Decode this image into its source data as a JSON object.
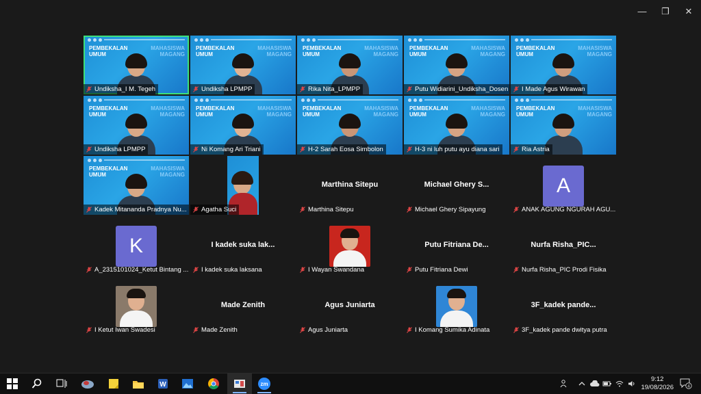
{
  "window": {
    "minimize": "—",
    "restore": "❐",
    "close": "✕"
  },
  "slide": {
    "title_line1": "PEMBEKALAN",
    "title_line2": "UMUM",
    "right_line1": "MAHASISWA",
    "right_line2": "MAGANG"
  },
  "tiles": [
    {
      "kind": "video",
      "name": "Undiksha_I M. Tegeh",
      "active": true
    },
    {
      "kind": "video",
      "name": "Undiksha LPMPP"
    },
    {
      "kind": "video",
      "name": "Rika Nita_LPMPP"
    },
    {
      "kind": "video",
      "name": "Putu Widiarini_Undiksha_Dosen"
    },
    {
      "kind": "video",
      "name": "I Made Agus Wirawan"
    },
    {
      "kind": "video",
      "name": "Undiksha LPMPP"
    },
    {
      "kind": "video",
      "name": "Ni Komang Ari Triani"
    },
    {
      "kind": "video",
      "name": "H-2 Sarah Eosa Simbolon"
    },
    {
      "kind": "video",
      "name": "H-3 ni luh putu ayu diana sari"
    },
    {
      "kind": "video",
      "name": "Ria Astria"
    },
    {
      "kind": "video",
      "name": "Kadek Mitananda Pradnya Nu..."
    },
    {
      "kind": "photo-video",
      "name": "Agatha Suci"
    },
    {
      "kind": "text",
      "big": "Marthina Sitepu",
      "name": "Marthina Sitepu"
    },
    {
      "kind": "text",
      "big": "Michael Ghery S...",
      "name": "Michael Ghery Sipayung"
    },
    {
      "kind": "avatar",
      "letter": "A",
      "name": "ANAK AGUNG NGURAH AGU..."
    },
    {
      "kind": "avatar",
      "letter": "K",
      "name": "A_2315101024_Ketut Bintang ..."
    },
    {
      "kind": "text",
      "big": "I kadek suka lak...",
      "name": "I kadek suka laksana"
    },
    {
      "kind": "photo",
      "bg": "#c8261e",
      "name": "I Wayan Swandana"
    },
    {
      "kind": "text",
      "big": "Putu Fitriana De...",
      "name": "Putu Fitriana Dewi"
    },
    {
      "kind": "text",
      "big": "Nurfa Risha_PIC...",
      "name": "Nurfa Risha_PIC Prodi Fisika"
    },
    {
      "kind": "photo",
      "bg": "#8a7a6a",
      "name": "I Ketut Iwan Swadesi"
    },
    {
      "kind": "text",
      "big": "Made Zenith",
      "name": "Made Zenith"
    },
    {
      "kind": "text",
      "big": "Agus Juniarta",
      "name": "Agus Juniarta"
    },
    {
      "kind": "photo",
      "bg": "#2f86d6",
      "name": "I Komang Sumika Adinata"
    },
    {
      "kind": "text",
      "big": "3F_kadek pande...",
      "name": "3F_kadek pande dwitya putra"
    }
  ],
  "taskbar": {
    "icons": [
      "windows-start-icon",
      "search-icon",
      "task-view-icon",
      "app-icon",
      "sticky-notes-icon",
      "file-explorer-icon",
      "word-icon",
      "photos-icon",
      "chrome-icon",
      "app-active-icon",
      "zoom-icon"
    ],
    "zoom_label": "zm",
    "time": "9:12",
    "date": "19/08/2026",
    "notifications": "4"
  }
}
